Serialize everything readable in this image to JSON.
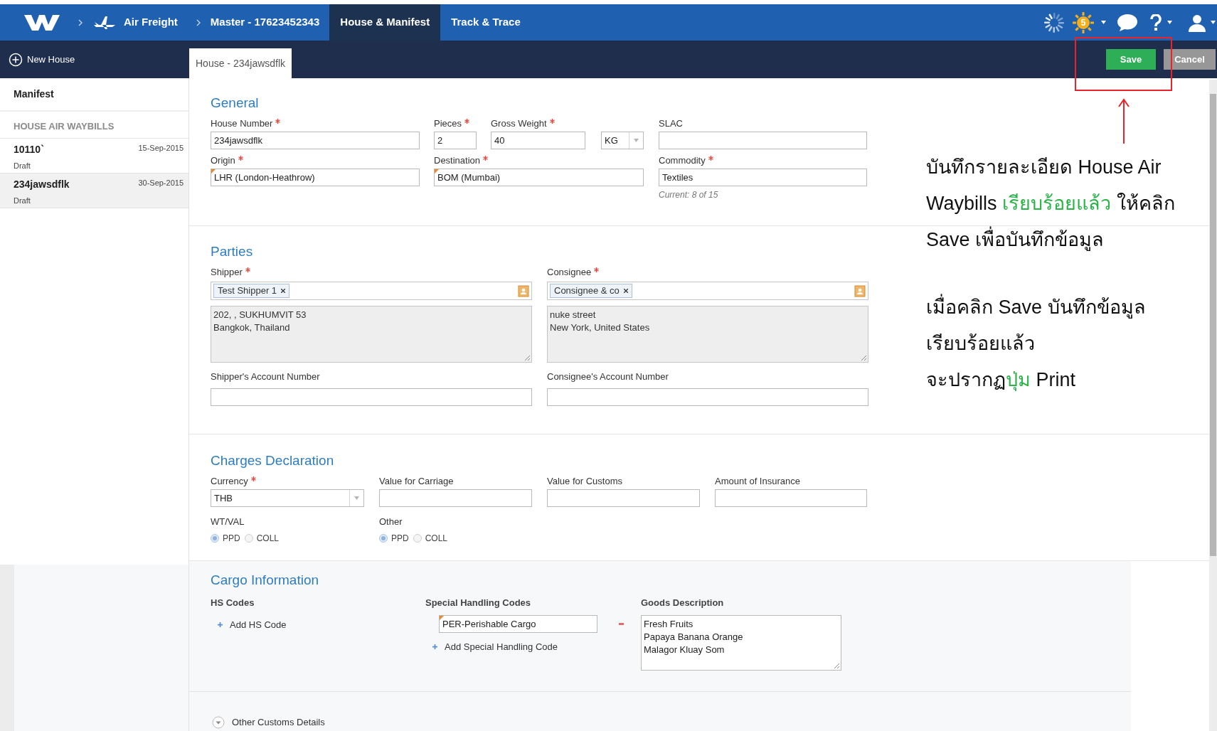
{
  "nav": {
    "breadcrumbs": [
      {
        "label": "Air Freight",
        "kind": "plane"
      },
      {
        "label": "Master - 17623452343",
        "kind": "plain"
      }
    ],
    "tabs": [
      {
        "label": "House & Manifest",
        "selected": true
      },
      {
        "label": "Track & Trace",
        "selected": false
      }
    ],
    "notification_count": "5"
  },
  "toolbar": {
    "new_house": "New House",
    "doc_tab": "House - 234jawsdflk",
    "save": "Save",
    "cancel": "Cancel"
  },
  "sidebar": {
    "title": "Manifest",
    "heading": "HOUSE AIR WAYBILLS",
    "items": [
      {
        "number": "10110`",
        "date": "15-Sep-2015",
        "status": "Draft",
        "selected": false
      },
      {
        "number": "234jawsdflk",
        "date": "30-Sep-2015",
        "status": "Draft",
        "selected": true
      }
    ]
  },
  "general": {
    "title": "General",
    "fields": [
      {
        "label": "House Number",
        "required": true,
        "value": "234jawsdflk",
        "kind": "text",
        "marked": false
      },
      {
        "label": "Pieces",
        "required": true,
        "value": "2",
        "kind": "text",
        "marked": false
      },
      {
        "label": "Gross Weight",
        "required": true,
        "value": "40",
        "kind": "text",
        "marked": false
      },
      {
        "value": "KG",
        "kind": "select",
        "marked": false
      },
      {
        "label": "SLAC",
        "required": false,
        "kind": "text",
        "marked": false
      },
      {
        "label": "Origin",
        "required": true,
        "value": "LHR (London-Heathrow)",
        "kind": "text",
        "marked": true
      },
      {
        "label": "Destination",
        "required": true,
        "value": "BOM (Mumbai)",
        "kind": "text",
        "marked": true
      },
      {
        "label": "Commodity",
        "required": true,
        "value": "Textiles",
        "kind": "text",
        "marked": false,
        "hint": "Current: 8 of 15"
      }
    ]
  },
  "parties": {
    "title": "Parties",
    "items": [
      {
        "label": "Shipper",
        "required": true,
        "tag": "Test Shipper 1",
        "address": [
          "202, , SUKHUMVIT 53",
          "Bangkok, Thailand"
        ],
        "account_label": "Shipper's Account Number"
      },
      {
        "label": "Consignee",
        "required": true,
        "tag": "Consignee & co",
        "address": [
          "nuke street",
          "New York, United States"
        ],
        "account_label": "Consignee's Account Number"
      }
    ]
  },
  "charges": {
    "title": "Charges Declaration",
    "fields": [
      {
        "label": "Currency",
        "required": true,
        "value": "THB",
        "kind": "select"
      },
      {
        "label": "Value for Carriage",
        "required": false,
        "kind": "text"
      },
      {
        "label": "Value for Customs",
        "required": false,
        "kind": "text"
      },
      {
        "label": "Amount of Insurance",
        "required": false,
        "kind": "text"
      }
    ],
    "radio_groups": [
      {
        "label": "WT/VAL",
        "options": [
          {
            "label": "PPD",
            "selected": true
          },
          {
            "label": "COLL",
            "selected": false
          }
        ]
      },
      {
        "label": "Other",
        "options": [
          {
            "label": "PPD",
            "selected": true
          },
          {
            "label": "COLL",
            "selected": false
          }
        ]
      }
    ]
  },
  "cargo": {
    "title": "Cargo Information",
    "hs_label": "HS Codes",
    "hs_add": "Add HS Code",
    "shc_label": "Special Handling Codes",
    "shc_value": "PER-Perishable Cargo",
    "shc_add": "Add Special Handling Code",
    "goods_label": "Goods Description",
    "goods_lines": [
      "Fresh Fruits",
      "Papaya Banana Orange",
      "Malagor Kluay Som"
    ]
  },
  "other_customs": "Other Customs Details",
  "annotation": {
    "paragraphs": [
      [
        [
          {
            "text": "บันทึกรายละเอียด House Air",
            "highlight": false
          }
        ],
        [
          {
            "text": "Waybills ",
            "highlight": false
          },
          {
            "text": "เรียบร้อยแล้ว",
            "highlight": true
          },
          {
            "text": " ให้คลิก",
            "highlight": false
          }
        ],
        [
          {
            "text": "Save เพื่อบันทึกข้อมูล",
            "highlight": false
          }
        ]
      ],
      [
        [
          {
            "text": "เมื่อคลิก Save บันทึกข้อมูล",
            "highlight": false
          }
        ],
        [
          {
            "text": "เรียบร้อยแล้ว",
            "highlight": false
          }
        ],
        [
          {
            "text": "จะปรากฏ",
            "highlight": false
          },
          {
            "text": "ปุ่ม",
            "highlight": true
          },
          {
            "text": " Print",
            "highlight": false
          }
        ]
      ]
    ]
  }
}
